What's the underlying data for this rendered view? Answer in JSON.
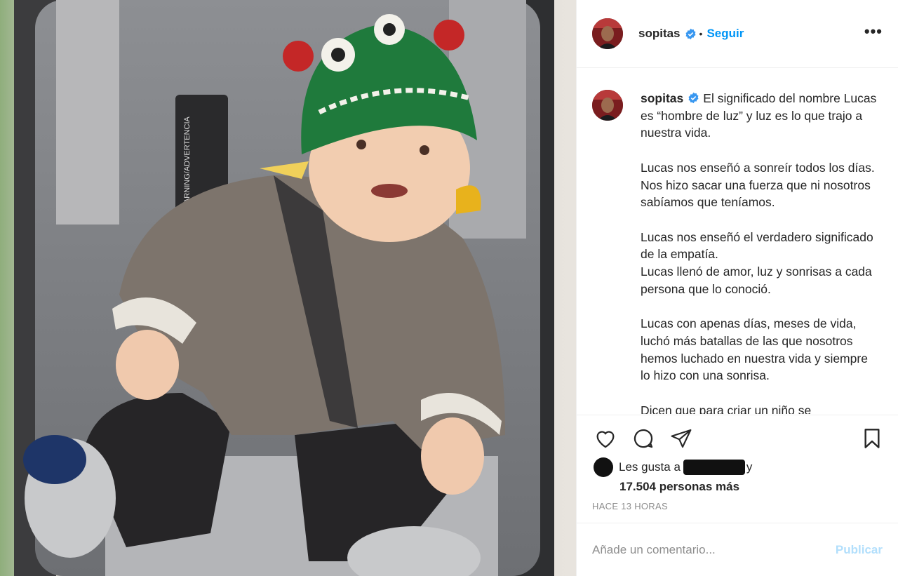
{
  "post": {
    "username": "sopitas",
    "verified": true,
    "follow_label": "Seguir",
    "more_label": "•••"
  },
  "caption": {
    "username": "sopitas",
    "paragraphs": [
      "El significado del nombre Lucas es “hombre de luz” y luz es lo que trajo a nuestra vida.",
      "Lucas nos enseñó a sonreír todos los días. Nos hizo sacar una fuerza que ni nosotros sabíamos que teníamos.",
      "Lucas nos enseñó el verdadero significado de la empatía.\nLucas llenó de amor, luz y sonrisas a cada persona que lo conoció.",
      "Lucas con apenas días, meses de vida, luchó más batallas de las que nosotros hemos luchado en nuestra vida y siempre lo hizo con una sonrisa.",
      "Dicen que para criar un niño se"
    ]
  },
  "actions": {
    "like_icon": "heart-icon",
    "comment_icon": "comment-icon",
    "share_icon": "paper-plane-icon",
    "save_icon": "bookmark-icon"
  },
  "likes": {
    "prefix": "Les gusta a",
    "suffix": "y",
    "count_text": "17.504 personas más"
  },
  "timestamp": "HACE 13 HORAS",
  "comment": {
    "placeholder": "Añade un comentario...",
    "publish_label": "Publicar"
  },
  "colors": {
    "link_blue": "#0095f6",
    "publish_disabled": "#b2dffc",
    "muted": "#8e8e8e"
  }
}
